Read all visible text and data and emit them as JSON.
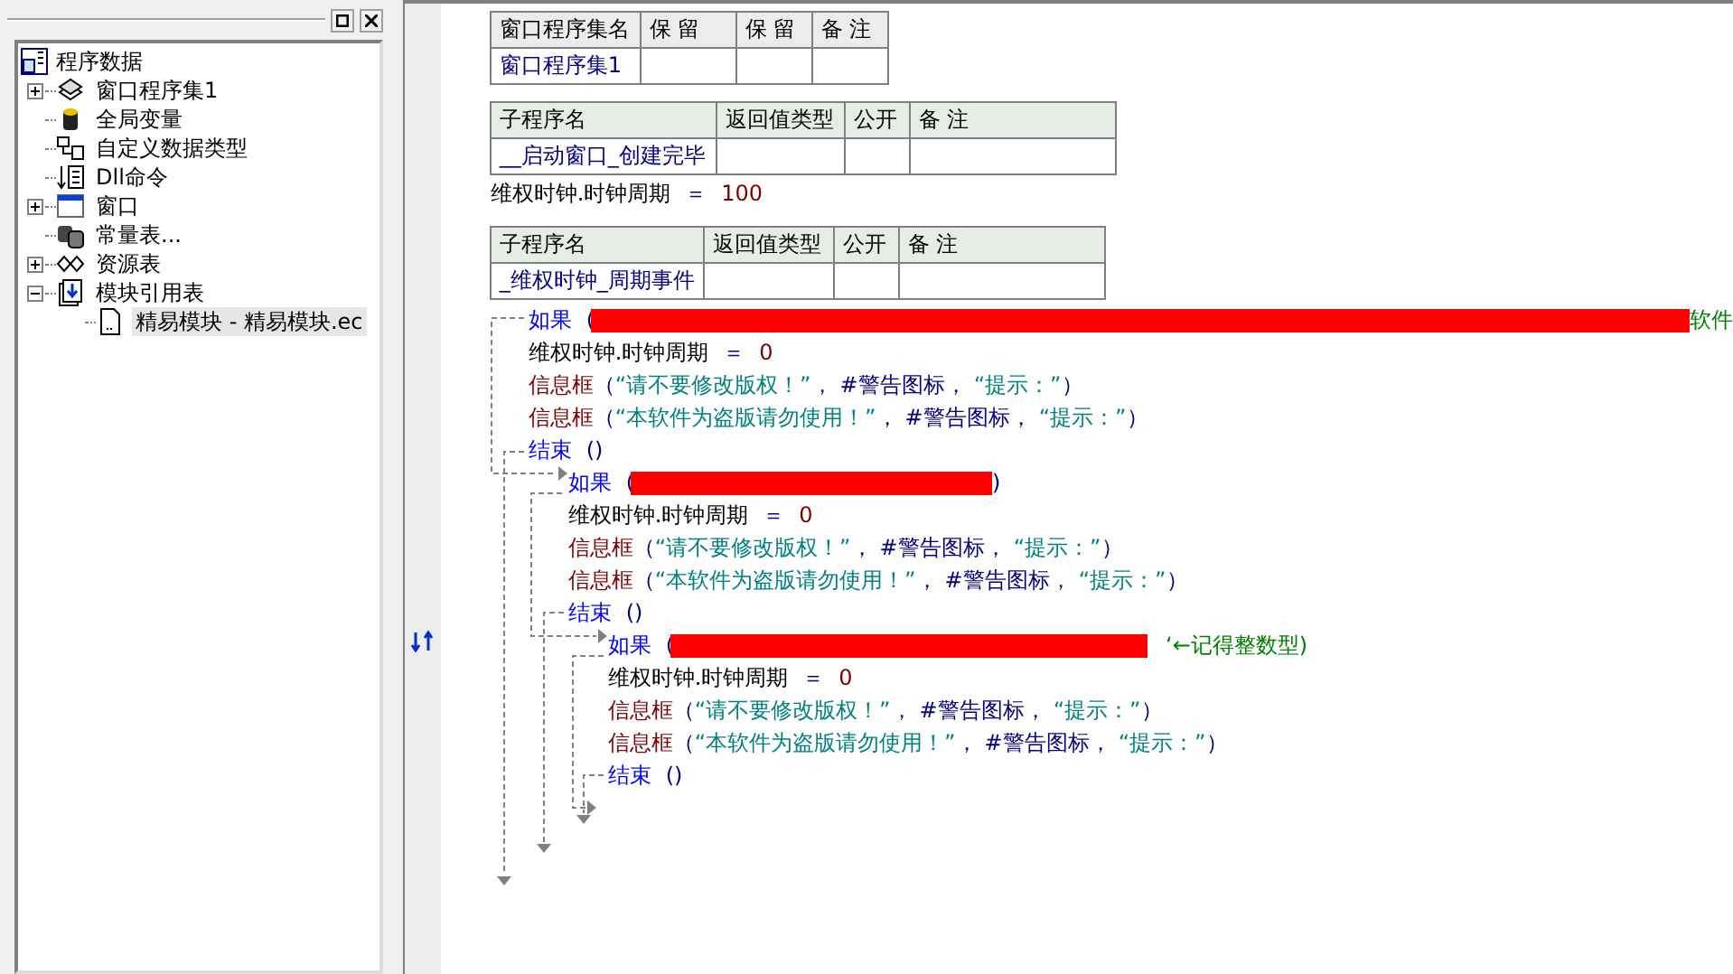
{
  "tree": {
    "label": "程序数据",
    "children": [
      {
        "label": "窗口程序集1",
        "expanded": false,
        "selected": false
      },
      {
        "label": "全局变量",
        "selected": false
      },
      {
        "label": "自定义数据类型",
        "selected": false
      },
      {
        "label": "Dll命令",
        "selected": false
      },
      {
        "label": "窗口",
        "expanded": false,
        "selected": false
      },
      {
        "label": "常量表...",
        "selected": false
      },
      {
        "label": "资源表",
        "expanded": false,
        "selected": false
      },
      {
        "label": "模块引用表",
        "expanded": true,
        "selected": false,
        "children": [
          {
            "label": "精易模块 - 精易模块.ec",
            "selected": true
          }
        ]
      }
    ]
  },
  "module_table": {
    "columns": [
      "窗口程序集名",
      "保 留",
      "保 留",
      "备 注"
    ],
    "name": "窗口程序集1"
  },
  "subroutines": [
    {
      "columns": [
        "子程序名",
        "返回值类型",
        "公开",
        "备 注"
      ],
      "name": "__启动窗口_创建完毕",
      "body": [
        {
          "kind": "assign",
          "target": "维权时钟.时钟周期",
          "op": "＝",
          "value": "100"
        }
      ]
    },
    {
      "columns": [
        "子程序名",
        "返回值类型",
        "公开",
        "备 注"
      ],
      "name": "_维权时钟_周期事件",
      "body": [
        {
          "kind": "if",
          "keyword": "如果",
          "open": "(",
          "redacted": true,
          "comment": "软件",
          "children": [
            {
              "kind": "assign",
              "target": "维权时钟.时钟周期",
              "op": "＝",
              "value": "0"
            },
            {
              "kind": "call",
              "name": "信息框",
              "open": "（",
              "sep": "，",
              "close": "）",
              "args": [
                {
                  "kind": "string",
                  "text": "“请不要修改版权！”"
                },
                {
                  "kind": "constant",
                  "text": "#警告图标"
                },
                {
                  "kind": "string",
                  "text": "“提示：”"
                }
              ]
            },
            {
              "kind": "call",
              "name": "信息框",
              "open": "（",
              "sep": "，",
              "close": "）",
              "args": [
                {
                  "kind": "string",
                  "text": "“本软件为盗版请勿使用！”"
                },
                {
                  "kind": "constant",
                  "text": "#警告图标"
                },
                {
                  "kind": "string",
                  "text": "“提示：”"
                }
              ]
            }
          ],
          "end": {
            "keyword": "结束",
            "args": "()"
          },
          "else": [
            {
              "kind": "if",
              "keyword": "如果",
              "open": "(",
              "redacted": true,
              "close": ")",
              "children": [
                {
                  "kind": "assign",
                  "target": "维权时钟.时钟周期",
                  "op": "＝",
                  "value": "0"
                },
                {
                  "kind": "call",
                  "name": "信息框",
                  "open": "（",
                  "sep": "，",
                  "close": "）",
                  "args": [
                    {
                      "kind": "string",
                      "text": "“请不要修改版权！”"
                    },
                    {
                      "kind": "constant",
                      "text": "#警告图标"
                    },
                    {
                      "kind": "string",
                      "text": "“提示：”"
                    }
                  ]
                },
                {
                  "kind": "call",
                  "name": "信息框",
                  "open": "（",
                  "sep": "，",
                  "close": "）",
                  "args": [
                    {
                      "kind": "string",
                      "text": "“本软件为盗版请勿使用！”"
                    },
                    {
                      "kind": "constant",
                      "text": "#警告图标"
                    },
                    {
                      "kind": "string",
                      "text": "“提示：”"
                    }
                  ]
                }
              ],
              "end": {
                "keyword": "结束",
                "args": "()"
              },
              "else": [
                {
                  "kind": "if",
                  "keyword": "如果",
                  "open": "(",
                  "redacted": true,
                  "comment": "‘←记得整数型)",
                  "children": [
                    {
                      "kind": "assign",
                      "target": "维权时钟.时钟周期",
                      "op": "＝",
                      "value": "0"
                    },
                    {
                      "kind": "call",
                      "name": "信息框",
                      "open": "（",
                      "sep": "，",
                      "close": "）",
                      "args": [
                        {
                          "kind": "string",
                          "text": "“请不要修改版权！”"
                        },
                        {
                          "kind": "constant",
                          "text": "#警告图标"
                        },
                        {
                          "kind": "string",
                          "text": "“提示：”"
                        }
                      ]
                    },
                    {
                      "kind": "call",
                      "name": "信息框",
                      "open": "（",
                      "sep": "，",
                      "close": "）",
                      "args": [
                        {
                          "kind": "string",
                          "text": "“本软件为盗版请勿使用！”"
                        },
                        {
                          "kind": "constant",
                          "text": "#警告图标"
                        },
                        {
                          "kind": "string",
                          "text": "“提示：”"
                        }
                      ]
                    }
                  ],
                  "end": {
                    "keyword": "结束",
                    "args": "()"
                  }
                }
              ]
            }
          ]
        }
      ]
    }
  ]
}
